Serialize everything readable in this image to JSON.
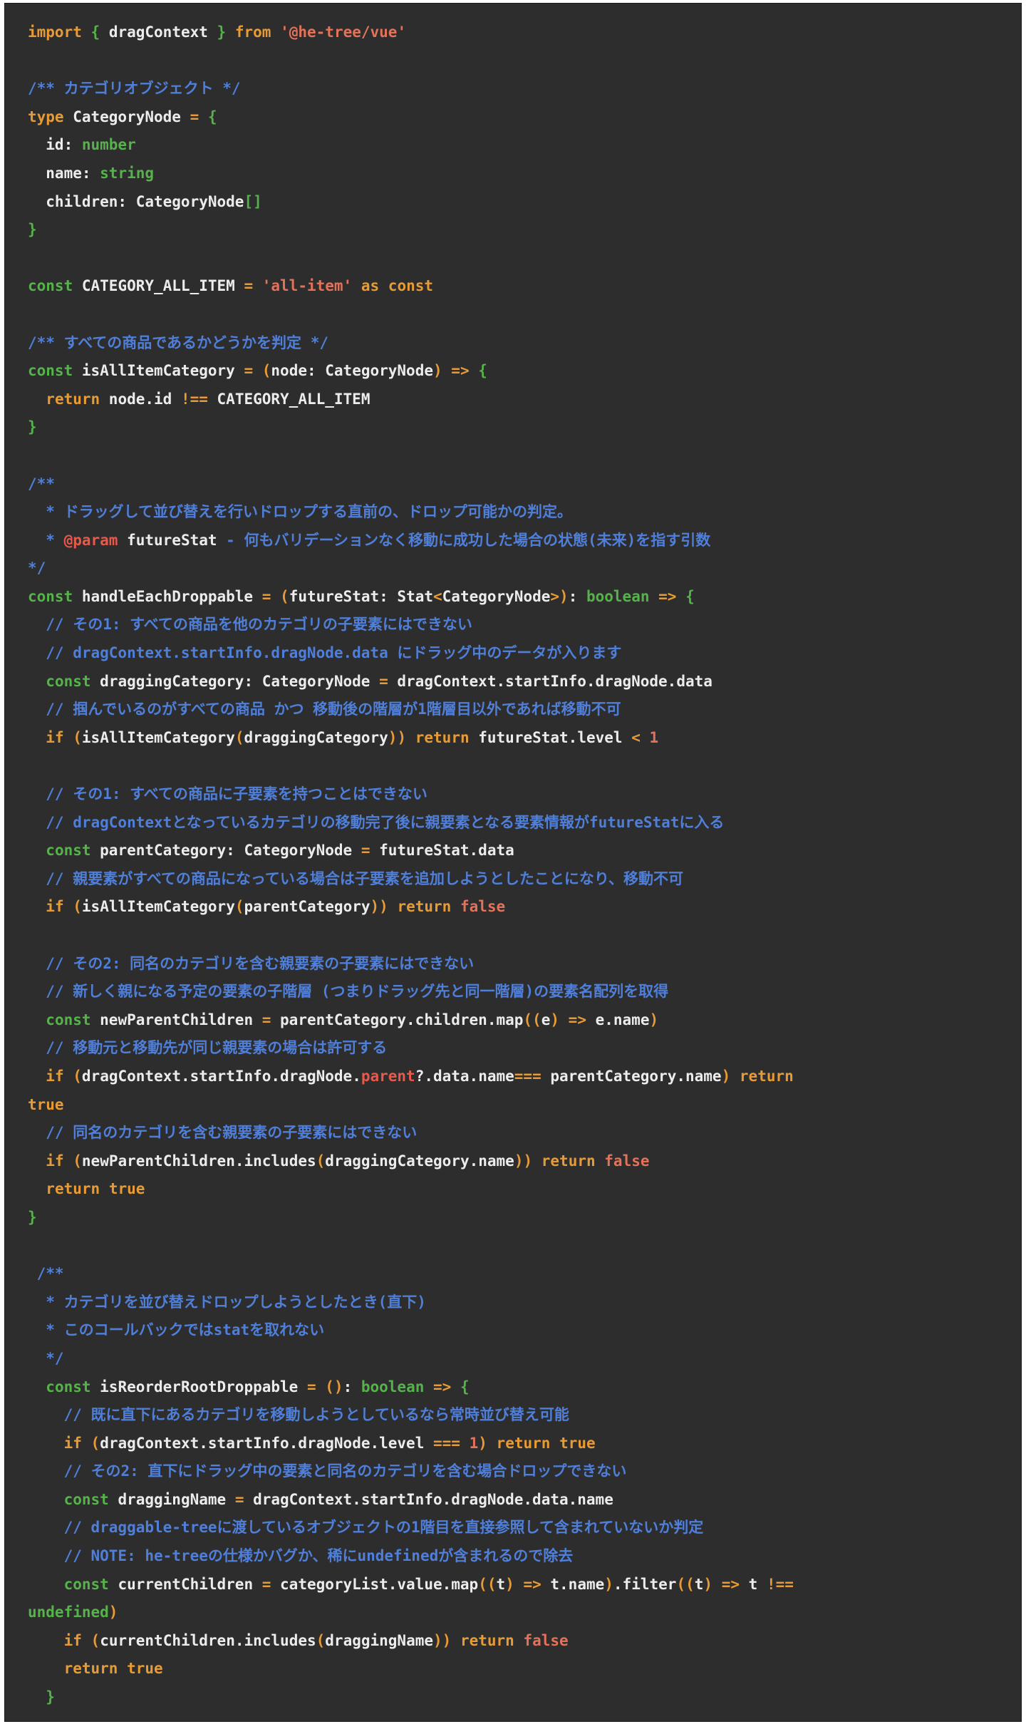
{
  "colors": {
    "background": "#2d2d2d",
    "keyword": "#e69b36",
    "plain": "#ececec",
    "type": "#56b24a",
    "string": "#e3725a",
    "comment": "#4f7fd9",
    "highlight": "#e8594c"
  },
  "code_lines": [
    [
      [
        "kw",
        "import"
      ],
      [
        "pl",
        " "
      ],
      [
        "ty",
        "{"
      ],
      [
        "pl",
        " dragContext "
      ],
      [
        "ty",
        "}"
      ],
      [
        "pl",
        " "
      ],
      [
        "kw",
        "from"
      ],
      [
        "pl",
        " "
      ],
      [
        "str",
        "'@he-tree/vue'"
      ]
    ],
    [],
    [
      [
        "cm",
        "/** カテゴリオブジェクト */"
      ]
    ],
    [
      [
        "kw",
        "type"
      ],
      [
        "pl",
        " CategoryNode "
      ],
      [
        "kw",
        "="
      ],
      [
        "pl",
        " "
      ],
      [
        "ty",
        "{"
      ]
    ],
    [
      [
        "pl",
        "  id: "
      ],
      [
        "ty",
        "number"
      ]
    ],
    [
      [
        "pl",
        "  name: "
      ],
      [
        "ty",
        "string"
      ]
    ],
    [
      [
        "pl",
        "  children: CategoryNode"
      ],
      [
        "ty",
        "[]"
      ]
    ],
    [
      [
        "ty",
        "}"
      ]
    ],
    [],
    [
      [
        "ty",
        "const"
      ],
      [
        "pl",
        " CATEGORY_ALL_ITEM "
      ],
      [
        "kw",
        "="
      ],
      [
        "pl",
        " "
      ],
      [
        "str",
        "'all-item'"
      ],
      [
        "pl",
        " "
      ],
      [
        "kw",
        "as"
      ],
      [
        "pl",
        " "
      ],
      [
        "kw",
        "const"
      ]
    ],
    [],
    [
      [
        "cm",
        "/** すべての商品であるかどうかを判定 */"
      ]
    ],
    [
      [
        "ty",
        "const"
      ],
      [
        "pl",
        " isAllItemCategory "
      ],
      [
        "kw",
        "="
      ],
      [
        "pl",
        " "
      ],
      [
        "kw",
        "("
      ],
      [
        "pl",
        "node: CategoryNode"
      ],
      [
        "kw",
        ")"
      ],
      [
        "pl",
        " "
      ],
      [
        "kw",
        "=>"
      ],
      [
        "pl",
        " "
      ],
      [
        "ty",
        "{"
      ]
    ],
    [
      [
        "pl",
        "  "
      ],
      [
        "kw",
        "return"
      ],
      [
        "pl",
        " node.id "
      ],
      [
        "kw",
        "!=="
      ],
      [
        "pl",
        " CATEGORY_ALL_ITEM"
      ]
    ],
    [
      [
        "ty",
        "}"
      ]
    ],
    [],
    [
      [
        "cm",
        "/**"
      ]
    ],
    [
      [
        "cm",
        "  * ドラッグして並び替えを行いドロップする直前の、ドロップ可能かの判定。"
      ]
    ],
    [
      [
        "cm",
        "  * "
      ],
      [
        "red",
        "@param"
      ],
      [
        "pl",
        " futureStat"
      ],
      [
        "cm",
        " - 何もバリデーションなく移動に成功した場合の状態(未来)を指す引数"
      ]
    ],
    [
      [
        "cm",
        "*/"
      ]
    ],
    [
      [
        "ty",
        "const"
      ],
      [
        "pl",
        " handleEachDroppable "
      ],
      [
        "kw",
        "="
      ],
      [
        "pl",
        " "
      ],
      [
        "kw",
        "("
      ],
      [
        "pl",
        "futureStat: Stat"
      ],
      [
        "kw",
        "<"
      ],
      [
        "pl",
        "CategoryNode"
      ],
      [
        "kw",
        ">"
      ],
      [
        "kw",
        ")"
      ],
      [
        "pl",
        ": "
      ],
      [
        "ty",
        "boolean"
      ],
      [
        "pl",
        " "
      ],
      [
        "kw",
        "=>"
      ],
      [
        "pl",
        " "
      ],
      [
        "ty",
        "{"
      ]
    ],
    [
      [
        "cm",
        "  // その1: すべての商品を他のカテゴリの子要素にはできない"
      ]
    ],
    [
      [
        "cm",
        "  // dragContext.startInfo.dragNode.data にドラッグ中のデータが入ります"
      ]
    ],
    [
      [
        "pl",
        "  "
      ],
      [
        "ty",
        "const"
      ],
      [
        "pl",
        " draggingCategory: CategoryNode "
      ],
      [
        "kw",
        "="
      ],
      [
        "pl",
        " dragContext.startInfo.dragNode.data"
      ]
    ],
    [
      [
        "cm",
        "  // 掴んでいるのがすべての商品 かつ 移動後の階層が1階層目以外であれば移動不可"
      ]
    ],
    [
      [
        "pl",
        "  "
      ],
      [
        "kw",
        "if"
      ],
      [
        "pl",
        " "
      ],
      [
        "kw",
        "("
      ],
      [
        "pl",
        "isAllItemCategory"
      ],
      [
        "kw",
        "("
      ],
      [
        "pl",
        "draggingCategory"
      ],
      [
        "kw",
        "))"
      ],
      [
        "pl",
        " "
      ],
      [
        "kw",
        "return"
      ],
      [
        "pl",
        " futureStat.level "
      ],
      [
        "kw",
        "<"
      ],
      [
        "pl",
        " "
      ],
      [
        "str",
        "1"
      ]
    ],
    [],
    [
      [
        "cm",
        "  // その1: すべての商品に子要素を持つことはできない"
      ]
    ],
    [
      [
        "cm",
        "  // dragContextとなっているカテゴリの移動完了後に親要素となる要素情報がfutureStatに入る"
      ]
    ],
    [
      [
        "pl",
        "  "
      ],
      [
        "ty",
        "const"
      ],
      [
        "pl",
        " parentCategory: CategoryNode "
      ],
      [
        "kw",
        "="
      ],
      [
        "pl",
        " futureStat.data"
      ]
    ],
    [
      [
        "cm",
        "  // 親要素がすべての商品になっている場合は子要素を追加しようとしたことになり、移動不可"
      ]
    ],
    [
      [
        "pl",
        "  "
      ],
      [
        "kw",
        "if"
      ],
      [
        "pl",
        " "
      ],
      [
        "kw",
        "("
      ],
      [
        "pl",
        "isAllItemCategory"
      ],
      [
        "kw",
        "("
      ],
      [
        "pl",
        "parentCategory"
      ],
      [
        "kw",
        "))"
      ],
      [
        "pl",
        " "
      ],
      [
        "kw",
        "return"
      ],
      [
        "pl",
        " "
      ],
      [
        "str",
        "false"
      ]
    ],
    [],
    [
      [
        "cm",
        "  // その2: 同名のカテゴリを含む親要素の子要素にはできない"
      ]
    ],
    [
      [
        "cm",
        "  // 新しく親になる予定の要素の子階層 (つまりドラッグ先と同一階層)の要素名配列を取得"
      ]
    ],
    [
      [
        "pl",
        "  "
      ],
      [
        "ty",
        "const"
      ],
      [
        "pl",
        " newParentChildren "
      ],
      [
        "kw",
        "="
      ],
      [
        "pl",
        " parentCategory.children.map"
      ],
      [
        "kw",
        "(("
      ],
      [
        "pl",
        "e"
      ],
      [
        "kw",
        ")"
      ],
      [
        "pl",
        " "
      ],
      [
        "kw",
        "=>"
      ],
      [
        "pl",
        " e.name"
      ],
      [
        "kw",
        ")"
      ]
    ],
    [
      [
        "cm",
        "  // 移動元と移動先が同じ親要素の場合は許可する"
      ]
    ],
    [
      [
        "pl",
        "  "
      ],
      [
        "kw",
        "if"
      ],
      [
        "pl",
        " "
      ],
      [
        "kw",
        "("
      ],
      [
        "pl",
        "dragContext.startInfo.dragNode."
      ],
      [
        "red",
        "parent"
      ],
      [
        "pl",
        "?.data.name"
      ],
      [
        "kw",
        "==="
      ],
      [
        "pl",
        " parentCategory.name"
      ],
      [
        "kw",
        ")"
      ],
      [
        "pl",
        " "
      ],
      [
        "kw",
        "return"
      ]
    ],
    [
      [
        "kw",
        "true"
      ]
    ],
    [
      [
        "cm",
        "  // 同名のカテゴリを含む親要素の子要素にはできない"
      ]
    ],
    [
      [
        "pl",
        "  "
      ],
      [
        "kw",
        "if"
      ],
      [
        "pl",
        " "
      ],
      [
        "kw",
        "("
      ],
      [
        "pl",
        "newParentChildren.includes"
      ],
      [
        "kw",
        "("
      ],
      [
        "pl",
        "draggingCategory.name"
      ],
      [
        "kw",
        "))"
      ],
      [
        "pl",
        " "
      ],
      [
        "kw",
        "return"
      ],
      [
        "pl",
        " "
      ],
      [
        "str",
        "false"
      ]
    ],
    [
      [
        "pl",
        "  "
      ],
      [
        "kw",
        "return"
      ],
      [
        "pl",
        " "
      ],
      [
        "kw",
        "true"
      ]
    ],
    [
      [
        "ty",
        "}"
      ]
    ],
    [],
    [
      [
        "cm",
        " /**"
      ]
    ],
    [
      [
        "cm",
        "  * カテゴリを並び替えドロップしようとしたとき(直下)"
      ]
    ],
    [
      [
        "cm",
        "  * このコールバックではstatを取れない"
      ]
    ],
    [
      [
        "cm",
        "  */"
      ]
    ],
    [
      [
        "pl",
        "  "
      ],
      [
        "ty",
        "const"
      ],
      [
        "pl",
        " isReorderRootDroppable "
      ],
      [
        "kw",
        "="
      ],
      [
        "pl",
        " "
      ],
      [
        "kw",
        "()"
      ],
      [
        "pl",
        ": "
      ],
      [
        "ty",
        "boolean"
      ],
      [
        "pl",
        " "
      ],
      [
        "kw",
        "=>"
      ],
      [
        "pl",
        " "
      ],
      [
        "ty",
        "{"
      ]
    ],
    [
      [
        "cm",
        "    // 既に直下にあるカテゴリを移動しようとしているなら常時並び替え可能"
      ]
    ],
    [
      [
        "pl",
        "    "
      ],
      [
        "kw",
        "if"
      ],
      [
        "pl",
        " "
      ],
      [
        "kw",
        "("
      ],
      [
        "pl",
        "dragContext.startInfo.dragNode.level "
      ],
      [
        "kw",
        "==="
      ],
      [
        "pl",
        " "
      ],
      [
        "str",
        "1"
      ],
      [
        "kw",
        ")"
      ],
      [
        "pl",
        " "
      ],
      [
        "kw",
        "return"
      ],
      [
        "pl",
        " "
      ],
      [
        "kw",
        "true"
      ]
    ],
    [
      [
        "cm",
        "    // その2: 直下にドラッグ中の要素と同名のカテゴリを含む場合ドロップできない"
      ]
    ],
    [
      [
        "pl",
        "    "
      ],
      [
        "ty",
        "const"
      ],
      [
        "pl",
        " draggingName "
      ],
      [
        "kw",
        "="
      ],
      [
        "pl",
        " dragContext.startInfo.dragNode.data.name"
      ]
    ],
    [
      [
        "cm",
        "    // draggable-treeに渡しているオブジェクトの1階目を直接参照して含まれていないか判定"
      ]
    ],
    [
      [
        "cm",
        "    // NOTE: he-treeの仕様かバグか、稀にundefinedが含まれるので除去"
      ]
    ],
    [
      [
        "pl",
        "    "
      ],
      [
        "ty",
        "const"
      ],
      [
        "pl",
        " currentChildren "
      ],
      [
        "kw",
        "="
      ],
      [
        "pl",
        " categoryList.value.map"
      ],
      [
        "kw",
        "(("
      ],
      [
        "pl",
        "t"
      ],
      [
        "kw",
        ")"
      ],
      [
        "pl",
        " "
      ],
      [
        "kw",
        "=>"
      ],
      [
        "pl",
        " t.name"
      ],
      [
        "kw",
        ")"
      ],
      [
        "pl",
        ".filter"
      ],
      [
        "kw",
        "(("
      ],
      [
        "pl",
        "t"
      ],
      [
        "kw",
        ")"
      ],
      [
        "pl",
        " "
      ],
      [
        "kw",
        "=>"
      ],
      [
        "pl",
        " t "
      ],
      [
        "kw",
        "!=="
      ]
    ],
    [
      [
        "ty",
        "undefined"
      ],
      [
        "kw",
        ")"
      ]
    ],
    [
      [
        "pl",
        "    "
      ],
      [
        "kw",
        "if"
      ],
      [
        "pl",
        " "
      ],
      [
        "kw",
        "("
      ],
      [
        "pl",
        "currentChildren.includes"
      ],
      [
        "kw",
        "("
      ],
      [
        "pl",
        "draggingName"
      ],
      [
        "kw",
        "))"
      ],
      [
        "pl",
        " "
      ],
      [
        "kw",
        "return"
      ],
      [
        "pl",
        " "
      ],
      [
        "str",
        "false"
      ]
    ],
    [
      [
        "pl",
        "    "
      ],
      [
        "kw",
        "return"
      ],
      [
        "pl",
        " "
      ],
      [
        "kw",
        "true"
      ]
    ],
    [
      [
        "pl",
        "  "
      ],
      [
        "ty",
        "}"
      ]
    ]
  ]
}
